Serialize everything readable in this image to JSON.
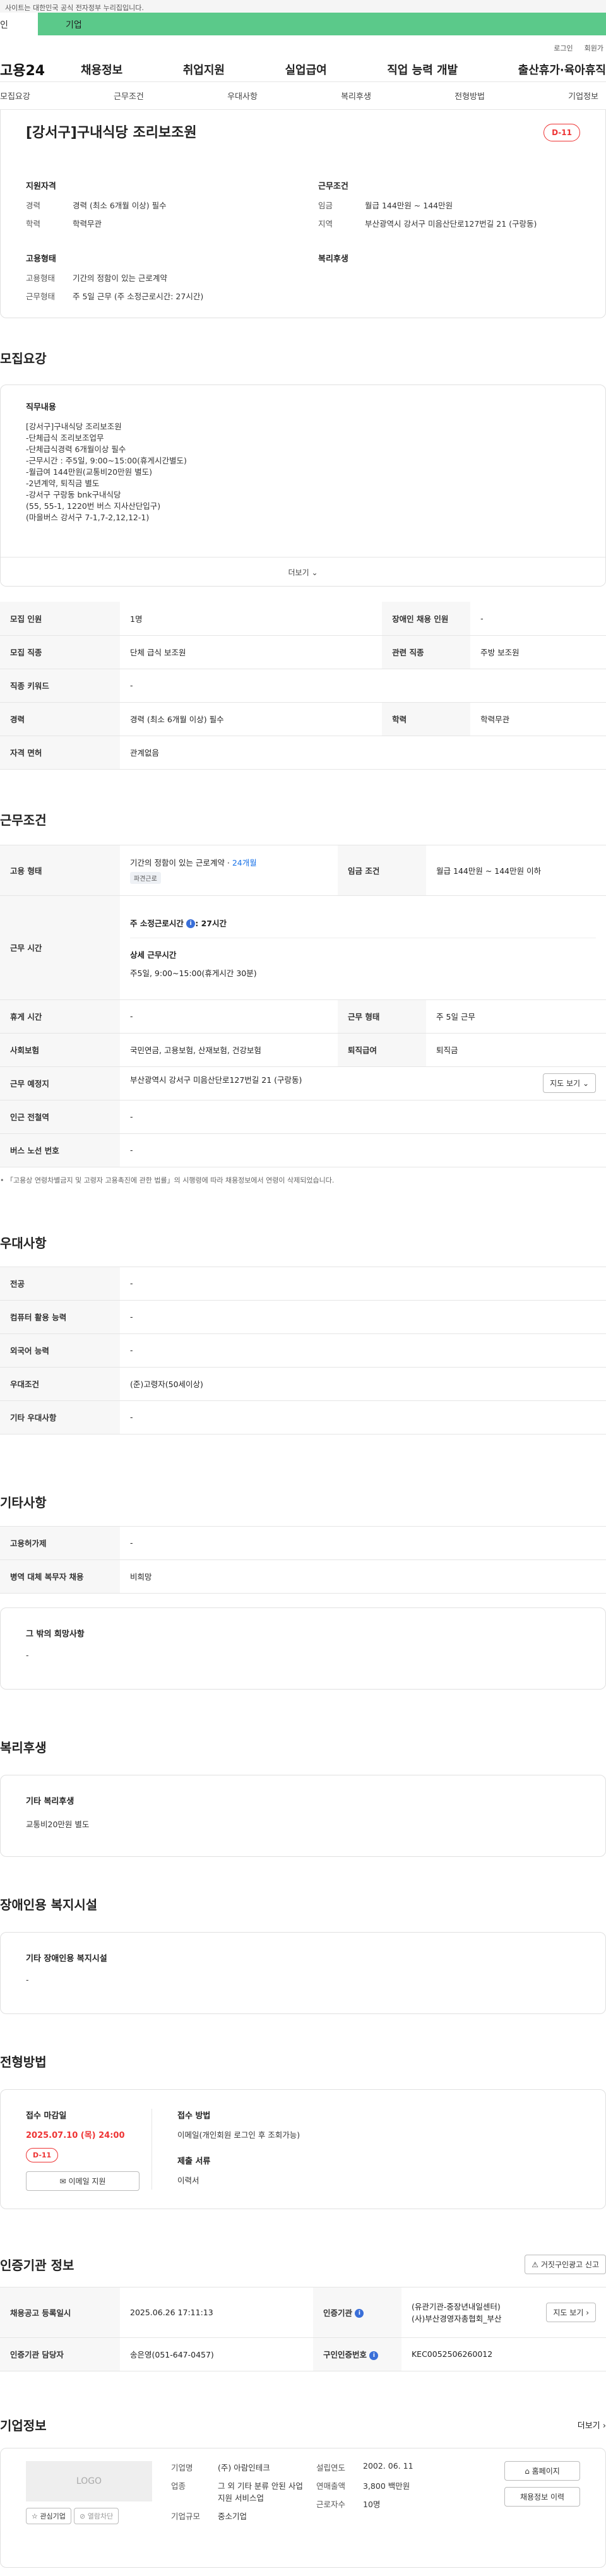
{
  "topbar": {
    "notice": "사이트는 대한민국 공식 전자정부 누리집입니다."
  },
  "tabs": {
    "tab1": "인",
    "tab2": "기업"
  },
  "util": {
    "login": "로그인",
    "join": "회원가"
  },
  "gnb": {
    "logo": "고용24",
    "menu": [
      "채용정보",
      "취업지원",
      "실업급여",
      "직업 능력 개발",
      "출산휴가·육아휴직"
    ]
  },
  "anchors": [
    "모집요강",
    "근무조건",
    "우대사항",
    "복리후생",
    "전형방법",
    "기업정보"
  ],
  "summary": {
    "title": "[강서구]구내식당 조리보조원",
    "dday": "D-11",
    "qual_title": "지원자격",
    "qual": [
      {
        "k": "경력",
        "v": "경력 (최소 6개월 이상) 필수"
      },
      {
        "k": "학력",
        "v": "학력무관"
      }
    ],
    "cond_title": "근무조건",
    "cond": [
      {
        "k": "임금",
        "v": "월급 144만원 ~ 144만원"
      },
      {
        "k": "지역",
        "v": "부산광역시 강서구 미음산단로127번길 21 (구랑동)"
      }
    ],
    "emp_title": "고용형태",
    "emp": [
      {
        "k": "고용형태",
        "v": "기간의 정함이 있는 근로계약"
      },
      {
        "k": "근무형태",
        "v": "주 5일 근무 (주 소정근로시간: 27시간)"
      }
    ],
    "welfare_title": "복리후생"
  },
  "recruit": {
    "title": "모집요강",
    "job_title": "직무내용",
    "job_lines": [
      "[강서구]구내식당 조리보조원",
      "-단체급식 조리보조업무",
      "-단체급식경력 6개월이상 필수",
      "-근무시간 : 주5일, 9:00~15:00(휴게시간별도)",
      "-월급여 144만원(교통비20만원 별도)",
      "-2년계약, 퇴직금 별도",
      "-강서구 구랑동 bnk구내식당",
      "(55, 55-1, 1220번 버스 지사산단입구)",
      "(마을버스 강서구 7-1,7-2,12,12-1)"
    ],
    "more": "더보기",
    "rows": [
      [
        "모집 인원",
        "1명",
        "장애인 채용 인원",
        "-"
      ],
      [
        "모집 직종",
        "단체 급식 보조원",
        "관련 직종",
        "주방 보조원"
      ],
      [
        "직종 키워드",
        "-"
      ],
      [
        "경력",
        "경력 (최소 6개월 이상) 필수",
        "학력",
        "학력무관"
      ],
      [
        "자격 면허",
        "관계없음"
      ]
    ]
  },
  "work": {
    "title": "근무조건",
    "emp_label": "고용 형태",
    "emp_value": "기간의 정함이 있는 근로계약 · ",
    "emp_months": "24개월",
    "emp_chip": "파견근로",
    "wage_label": "임금 조건",
    "wage_value": "월급 144만원 ~ 144만원 이하",
    "time_label": "근무 시간",
    "time_std": "주 소정근로시간",
    "time_std_val": ": 27시간",
    "time_detail_title": "상세 근무시간",
    "time_detail": "주5일, 9:00~15:00(휴게시간 30분)",
    "rows": [
      [
        "휴게 시간",
        "-",
        "근무 형태",
        "주 5일 근무"
      ],
      [
        "사회보험",
        "국민연금, 고용보험, 산재보험, 건강보험",
        "퇴직급여",
        "퇴직금"
      ]
    ],
    "place_label": "근무 예정지",
    "place_value": "부산광역시 강서구 미음산단로127번길 21 (구랑동)",
    "map_btn": "지도 보기",
    "station_label": "인근 전철역",
    "station_value": "-",
    "bus_label": "버스 노선 번호",
    "bus_value": "-",
    "note": "「고용상 연령차별금지 및 고령자 고용촉진에 관한 법률」의 시행령에 따라 채용정보에서 연령이 삭제되었습니다."
  },
  "prefer": {
    "title": "우대사항",
    "rows": [
      [
        "전공",
        "-"
      ],
      [
        "컴퓨터 활용 능력",
        "-"
      ],
      [
        "외국어 능력",
        "-"
      ],
      [
        "우대조건",
        "(준)고령자(50세이상)"
      ],
      [
        "기타 우대사항",
        "-"
      ]
    ]
  },
  "etc": {
    "title": "기타사항",
    "rows": [
      [
        "고용허가제",
        "-"
      ],
      [
        "병역 대체 복무자 채용",
        "비희망"
      ]
    ],
    "wish_title": "그 밖의 희망사항",
    "wish_value": "-"
  },
  "welfare": {
    "title": "복리후생",
    "sub": "기타 복리후생",
    "value": "교통비20만원 별도"
  },
  "disability": {
    "title": "장애인용 복지시설",
    "sub": "기타 장애인용 복지시설",
    "value": "-"
  },
  "screen": {
    "title": "전형방법",
    "deadline_title": "접수 마감일",
    "deadline": "2025.07.10 (목) 24:00",
    "dday": "D-11",
    "email_btn": "이메일 지원",
    "method_title": "접수 방법",
    "method": "이메일(개인회원 로그인 후 조회가능)",
    "docs_title": "제출 서류",
    "docs": "이력서"
  },
  "cert": {
    "title": "인증기관 정보",
    "report_btn": "거짓구인광고 신고",
    "r1": [
      "채용공고 등록일시",
      "2025.06.26 17:11:13",
      "인증기관"
    ],
    "cert_org": [
      "(유관기관-중장년내일센터)",
      "(사)부산경영자총협회_부산"
    ],
    "map_btn": "지도 보기",
    "r2": [
      "인증기관 담당자",
      "송은영(051-647-0457)",
      "구인인증번호",
      "KEC0052506260012"
    ]
  },
  "company": {
    "title": "기업정보",
    "more": "더보기",
    "logo": "LOGO",
    "fav_btn": "관심기업",
    "block_btn": "열람차단",
    "name_label": "기업명",
    "name": "(주) 아람인테크",
    "biz_label": "업종",
    "biz": "그 외 기타 분류 안된 사업지원 서비스업",
    "size_label": "기업규모",
    "size": "중소기업",
    "year_label": "설립연도",
    "year": "2002. 06. 11",
    "sales_label": "연매출액",
    "sales": "3,800 백만원",
    "emp_label": "근로자수",
    "emp": "10명",
    "home_btn": "홈페이지",
    "list_btn": "채용정보 이력"
  }
}
